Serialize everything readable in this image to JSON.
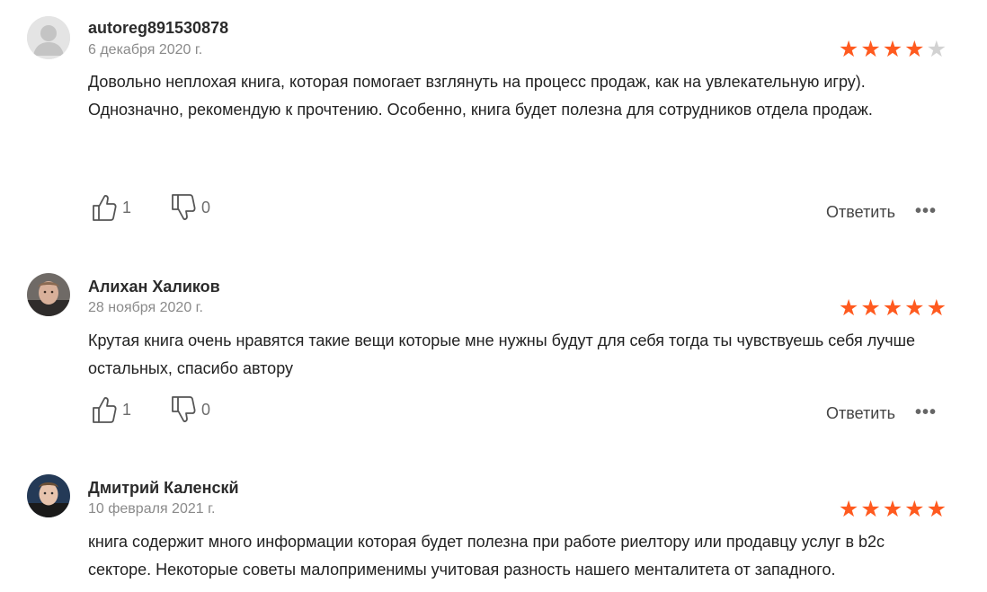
{
  "reviews": [
    {
      "author": "autoreg891530878",
      "date": "6 декабря 2020 г.",
      "rating": 4,
      "avatar": "default-avatar",
      "paragraphs": [
        "Довольно неплохая книга, которая помогает взглянуть на процесс продаж, как на увлекательную игру).",
        "Однозначно, рекомендую к прочтению. Особенно, книга будет полезна для сотрудников отдела продаж."
      ],
      "likes": "1",
      "dislikes": "0",
      "reply_label": "Ответить",
      "more_label": "•••"
    },
    {
      "author": "Алихан Халиков",
      "date": "28 ноября 2020 г.",
      "rating": 5,
      "avatar": "user-photo",
      "paragraphs": [
        "Крутая книга очень нравятся такие вещи которые мне нужны будут для себя тогда ты чувствуешь себя лучше остальных, спасибо автору"
      ],
      "likes": "1",
      "dislikes": "0",
      "reply_label": "Ответить",
      "more_label": "•••"
    },
    {
      "author": "Дмитрий Каленскй",
      "date": "10 февраля 2021 г.",
      "rating": 5,
      "avatar": "user-photo",
      "paragraphs": [
        "книга содержит много информации которая будет полезна при работе риелтору или продавцу услуг в b2c секторе. Некоторые советы малоприменимы учитовая разность нашего менталитета от западного."
      ]
    }
  ],
  "colors": {
    "star_on": "#ff5a1f",
    "star_off": "#d2d2d2"
  },
  "icons": {
    "like": "thumbs-up-icon",
    "dislike": "thumbs-down-icon",
    "more": "more-options-icon"
  }
}
